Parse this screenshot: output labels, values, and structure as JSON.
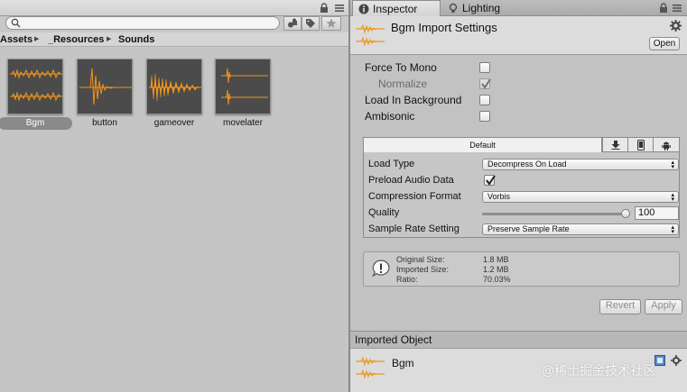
{
  "project": {
    "search": {
      "value": "",
      "placeholder": ""
    },
    "breadcrumb": [
      "Assets",
      "_Resources",
      "Sounds"
    ],
    "assets": [
      {
        "name": "Bgm",
        "selected": true
      },
      {
        "name": "button",
        "selected": false
      },
      {
        "name": "gameover",
        "selected": false
      },
      {
        "name": "movelater",
        "selected": false
      }
    ]
  },
  "inspector": {
    "tabs": [
      {
        "label": "Inspector",
        "icon": "info-icon",
        "active": true
      },
      {
        "label": "Lighting",
        "icon": "lighting-icon",
        "active": false
      }
    ],
    "header": {
      "title": "Bgm Import Settings",
      "open_label": "Open"
    },
    "props": {
      "force_to_mono": {
        "label": "Force To Mono",
        "checked": false
      },
      "normalize": {
        "label": "Normalize",
        "checked": true,
        "disabled": true
      },
      "load_in_background": {
        "label": "Load In Background",
        "checked": false
      },
      "ambisonic": {
        "label": "Ambisonic",
        "checked": false
      }
    },
    "platform": {
      "default_tab": "Default",
      "icons": [
        "download-icon",
        "mobile-icon",
        "android-icon"
      ],
      "load_type": {
        "label": "Load Type",
        "value": "Decompress On Load"
      },
      "preload_audio_data": {
        "label": "Preload Audio Data",
        "checked": true
      },
      "compression_format": {
        "label": "Compression Format",
        "value": "Vorbis"
      },
      "quality": {
        "label": "Quality",
        "value": "100",
        "fraction": 1.0
      },
      "sample_rate_setting": {
        "label": "Sample Rate Setting",
        "value": "Preserve Sample Rate"
      }
    },
    "info": {
      "original_size_label": "Original Size:",
      "original_size": "1.8 MB",
      "imported_size_label": "Imported Size:",
      "imported_size": "1.2 MB",
      "ratio_label": "Ratio:",
      "ratio": "70.03%"
    },
    "revert_label": "Revert",
    "apply_label": "Apply",
    "imported_object": {
      "header": "Imported Object",
      "name": "Bgm"
    }
  },
  "watermark": "@稀土掘金技术社区",
  "colors": {
    "waveform": "#f0951c",
    "thumb_bg": "#4b4b4b"
  }
}
